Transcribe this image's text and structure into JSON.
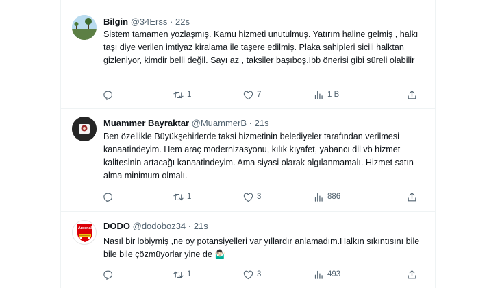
{
  "tweets": [
    {
      "name": "Bilgin",
      "handle": "@34Erss",
      "dot": "·",
      "time": "22s",
      "text": "Sistem tamamen yozlaşmış. Kamu hizmeti unutulmuş. Yatırım haline gelmiş , halkı taşı diye verilen imtiyaz kiralama ile taşere edilmiş. Plaka sahipleri sicili halktan gizleniyor, kimdir belli değil. Sayı az , taksiler başıboş.İbb önerisi gibi süreli olabilir",
      "replies": "",
      "retweets": "1",
      "likes": "7",
      "views": "1 B"
    },
    {
      "name": "Muammer Bayraktar",
      "handle": "@MuammerB",
      "dot": "·",
      "time": "21s",
      "text": "Ben özellikle Büyükşehirlerde taksi hizmetinin belediyeler tarafından verilmesi kanaatindeyim. Hem araç modernizasyonu, kılık kıyafet, yabancı dil vb hizmet kalitesinin artacağı kanaatindeyim. Ama siyasi olarak algılanmamalı. Hizmet satın alma minimum olmalı.",
      "replies": "",
      "retweets": "1",
      "likes": "3",
      "views": "886"
    },
    {
      "name": "DODO",
      "handle": "@dodoboz34",
      "dot": "·",
      "time": "21s",
      "text": "Nasıl bir lobiymiş ,ne oy potansiyelleri var yıllardır anlamadım.Halkın sıkıntısını bile bile bile çözmüyorlar yine de 🤷🏻‍♂️",
      "avatar_text": "Arsenal",
      "replies": "",
      "retweets": "1",
      "likes": "3",
      "views": "493"
    }
  ],
  "icons": {
    "reply": "reply-icon",
    "retweet": "retweet-icon",
    "like": "heart-icon",
    "views": "views-icon",
    "share": "share-icon"
  },
  "colors": {
    "text": "#0f1419",
    "secondary": "#536471",
    "border": "#eff3f4",
    "arsenal_red": "#db0007"
  }
}
